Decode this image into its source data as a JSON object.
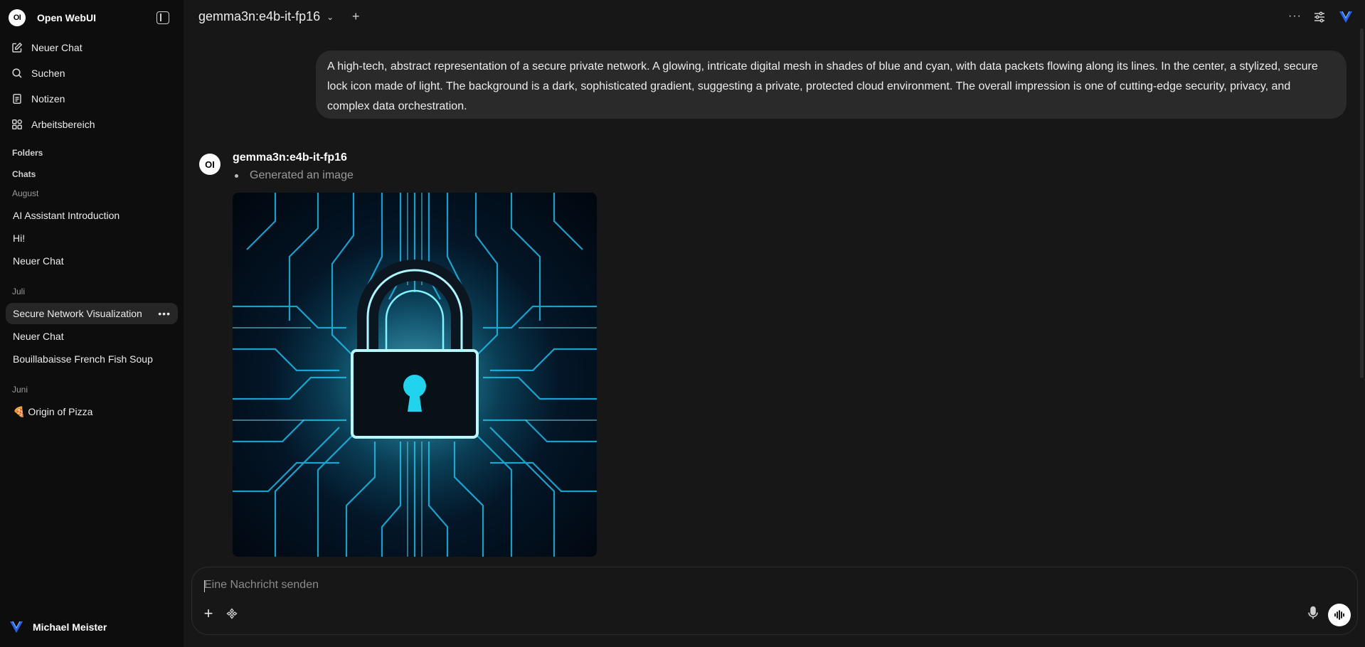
{
  "app": {
    "name": "Open WebUI",
    "logo_text": "OI"
  },
  "sidebar": {
    "nav": [
      {
        "label": "Neuer Chat",
        "icon": "pencil-square-icon"
      },
      {
        "label": "Suchen",
        "icon": "search-icon"
      },
      {
        "label": "Notizen",
        "icon": "notes-icon"
      },
      {
        "label": "Arbeitsbereich",
        "icon": "workspace-icon"
      }
    ],
    "folders_label": "Folders",
    "chats_label": "Chats",
    "groups": [
      {
        "month": "August",
        "chats": [
          "AI Assistant Introduction",
          "Hi!",
          "Neuer Chat"
        ]
      },
      {
        "month": "Juli",
        "chats": [
          "Secure Network Visualization",
          "Neuer Chat",
          "Bouillabaisse French Fish Soup"
        ]
      },
      {
        "month": "Juni",
        "chats": [
          "🍕 Origin of Pizza"
        ]
      }
    ],
    "active_chat": "Secure Network Visualization",
    "user": {
      "name": "Michael Meister"
    }
  },
  "header": {
    "model": "gemma3n:e4b-it-fp16"
  },
  "conversation": {
    "user_message": "A high-tech, abstract representation of a secure private network. A glowing, intricate digital mesh in shades of blue and cyan, with data packets flowing along its lines. In the center, a stylized, secure lock icon made of light. The background is a dark, sophisticated gradient, suggesting a private, protected cloud environment. The overall impression is one of cutting-edge security, privacy, and complex data orchestration.",
    "assistant": {
      "name": "gemma3n:e4b-it-fp16",
      "status": "Generated an image"
    }
  },
  "composer": {
    "placeholder": "Eine Nachricht senden"
  },
  "colors": {
    "background": "#171717",
    "sidebar": "#0d0d0d",
    "accent_cyan": "#22d3ee",
    "user_bubble": "#2a2a2a"
  }
}
